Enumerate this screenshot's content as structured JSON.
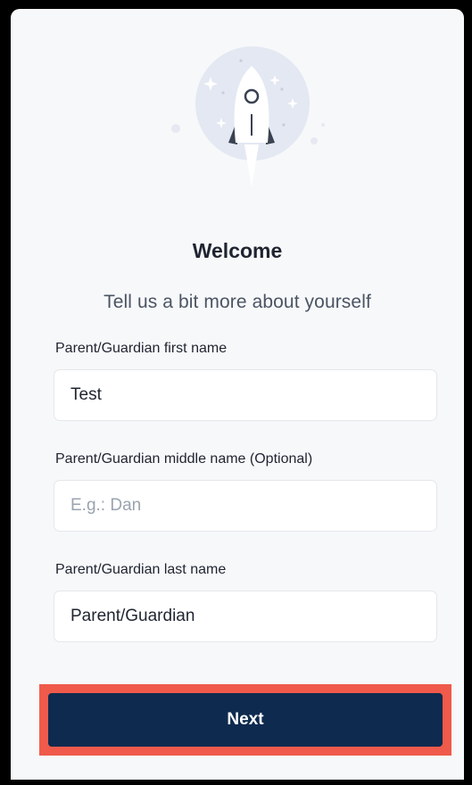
{
  "welcome": {
    "title": "Welcome",
    "subtitle": "Tell us a bit more about yourself"
  },
  "form": {
    "first_name": {
      "label": "Parent/Guardian first name",
      "value": "Test",
      "placeholder": ""
    },
    "middle_name": {
      "label": "Parent/Guardian middle name (Optional)",
      "value": "",
      "placeholder": "E.g.: Dan"
    },
    "last_name": {
      "label": "Parent/Guardian last name",
      "value": "Parent/Guardian",
      "placeholder": ""
    }
  },
  "actions": {
    "next_label": "Next"
  },
  "colors": {
    "primary": "#0e2a4f",
    "highlight": "#ef5a4b",
    "card_bg": "#f7f8fa"
  },
  "icons": {
    "hero": "rocket-icon"
  }
}
